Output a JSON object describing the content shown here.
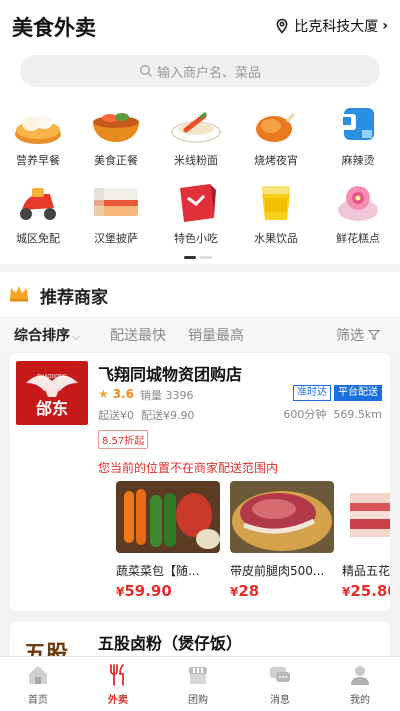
{
  "header": {
    "title": "美食外卖",
    "location": "比克科技大厦",
    "location_icon": "map-pin-icon"
  },
  "search": {
    "placeholder": "输入商户名、菜品"
  },
  "categories": [
    {
      "label": "营养早餐",
      "icon": "breakfast-icon"
    },
    {
      "label": "美食正餐",
      "icon": "meal-bowl-icon"
    },
    {
      "label": "米线粉面",
      "icon": "noodles-icon"
    },
    {
      "label": "烧烤夜宵",
      "icon": "roast-chicken-icon"
    },
    {
      "label": "麻辣烫",
      "icon": "spicy-pot-icon"
    },
    {
      "label": "城区免配",
      "icon": "delivery-scooter-icon"
    },
    {
      "label": "汉堡披萨",
      "icon": "burger-icon"
    },
    {
      "label": "特色小吃",
      "icon": "gift-snack-icon"
    },
    {
      "label": "水果饮品",
      "icon": "drink-cup-icon"
    },
    {
      "label": "鲜花糕点",
      "icon": "flower-cake-icon"
    }
  ],
  "pager": {
    "pages": 2,
    "current": 1
  },
  "recommend": {
    "title": "推荐商家",
    "icon": "crown-icon"
  },
  "filters": {
    "sort": "综合排序",
    "fastest": "配送最快",
    "top_sales": "销量最高",
    "filter": "筛选"
  },
  "shop": {
    "name": "飞翔同城物资团购店",
    "logo_text": "邰东",
    "logo_sub": "SHAODONG",
    "rating": "3.6",
    "sales": "销量 3396",
    "badges": [
      "准时达",
      "平台配送"
    ],
    "fees": "起送¥0  配送¥9.90",
    "timing": "600分钟  569.5km",
    "discount": "8.57折起",
    "notice": "您当前的位置不在商家配送范围内",
    "products": [
      {
        "name": "蔬菜菜包【随...",
        "price": "59.90"
      },
      {
        "name": "带皮前腿肉500...",
        "price": "28"
      },
      {
        "name": "精品五花",
        "price": "25.80"
      }
    ]
  },
  "shop2": {
    "name": "五股卤粉（煲仔饭）",
    "logo_text": "五股"
  },
  "tabs": [
    {
      "label": "首页",
      "icon": "home-icon",
      "active": false
    },
    {
      "label": "外卖",
      "icon": "utensils-icon",
      "active": true
    },
    {
      "label": "团购",
      "icon": "store-icon",
      "active": false
    },
    {
      "label": "消息",
      "icon": "message-icon",
      "active": false
    },
    {
      "label": "我的",
      "icon": "user-icon",
      "active": false
    }
  ],
  "colors": {
    "accent": "#e0302a",
    "link_blue": "#1a6fe0",
    "rating": "#f08b18"
  }
}
